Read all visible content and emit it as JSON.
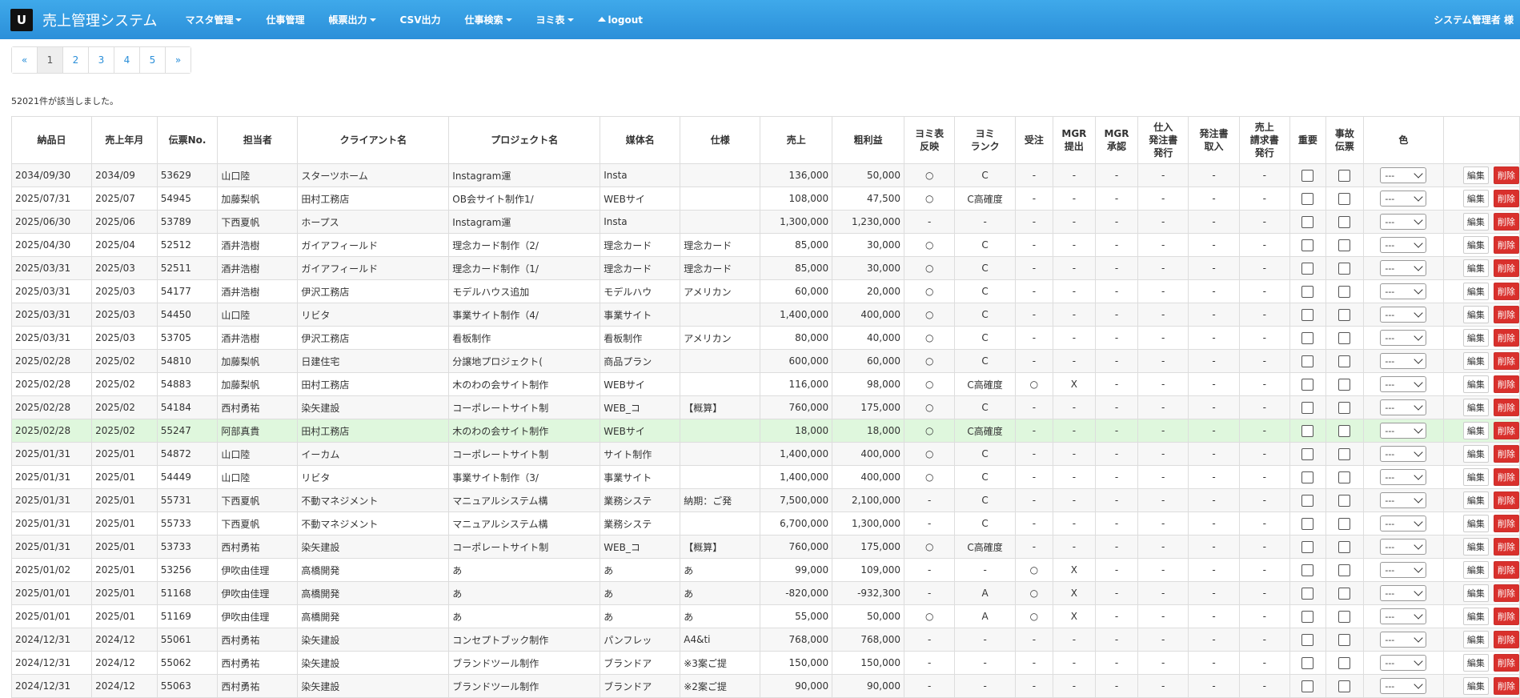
{
  "header": {
    "logo_glyph": "U",
    "title": "売上管理システム",
    "nav": [
      {
        "label": "マスタ管理",
        "dropdown": true
      },
      {
        "label": "仕事管理",
        "dropdown": false
      },
      {
        "label": "帳票出力",
        "dropdown": true
      },
      {
        "label": "CSV出力",
        "dropdown": false
      },
      {
        "label": "仕事検索",
        "dropdown": true
      },
      {
        "label": "ヨミ表",
        "dropdown": true
      }
    ],
    "logout_label": "logout",
    "user": "システム管理者 様"
  },
  "pagination": [
    "«",
    "1",
    "2",
    "3",
    "4",
    "5",
    "»"
  ],
  "pagination_active": "1",
  "result_count": "52021件が該当しました。",
  "columns": [
    "納品日",
    "売上年月",
    "伝票No.",
    "担当者",
    "クライアント名",
    "プロジェクト名",
    "媒体名",
    "仕様",
    "売上",
    "粗利益",
    "ヨミ表\n反映",
    "ヨミ\nランク",
    "受注",
    "MGR\n提出",
    "MGR\n承認",
    "仕入\n発注書\n発行",
    "発注書\n取入",
    "売上\n請求書\n発行",
    "重要",
    "事故\n伝票",
    "色",
    ""
  ],
  "select_default": "---",
  "edit_label": "編集",
  "delete_label": "削除",
  "colors": {
    "navbar": "#2b8fd9",
    "delete": "#d9302c",
    "highlight": "#dff7dd"
  },
  "rows": [
    [
      "2034/09/30",
      "2034/09",
      "53629",
      "山口陸",
      "スターツホーム",
      "Instagram運",
      "Insta",
      "",
      "136,000",
      "50,000",
      "○",
      "C",
      "-",
      "-",
      "-",
      "-",
      "-",
      "-"
    ],
    [
      "2025/07/31",
      "2025/07",
      "54945",
      "加藤梨帆",
      "田村工務店",
      "OB会サイト制作1/",
      "WEBサイ",
      "",
      "108,000",
      "47,500",
      "○",
      "C高確度",
      "-",
      "-",
      "-",
      "-",
      "-",
      "-"
    ],
    [
      "2025/06/30",
      "2025/06",
      "53789",
      "下西夏帆",
      "ホープス",
      "Instagram運",
      "Insta",
      "",
      "1,300,000",
      "1,230,000",
      "-",
      "-",
      "-",
      "-",
      "-",
      "-",
      "-",
      "-"
    ],
    [
      "2025/04/30",
      "2025/04",
      "52512",
      "酒井浩樹",
      "ガイアフィールド",
      "理念カード制作（2/",
      "理念カード",
      "理念カード",
      "85,000",
      "30,000",
      "○",
      "C",
      "-",
      "-",
      "-",
      "-",
      "-",
      "-"
    ],
    [
      "2025/03/31",
      "2025/03",
      "52511",
      "酒井浩樹",
      "ガイアフィールド",
      "理念カード制作（1/",
      "理念カード",
      "理念カード",
      "85,000",
      "30,000",
      "○",
      "C",
      "-",
      "-",
      "-",
      "-",
      "-",
      "-"
    ],
    [
      "2025/03/31",
      "2025/03",
      "54177",
      "酒井浩樹",
      "伊沢工務店",
      "モデルハウス追加",
      "モデルハウ",
      "アメリカン",
      "60,000",
      "20,000",
      "○",
      "C",
      "-",
      "-",
      "-",
      "-",
      "-",
      "-"
    ],
    [
      "2025/03/31",
      "2025/03",
      "54450",
      "山口陸",
      "リビタ",
      "事業サイト制作（4/",
      "事業サイト",
      "",
      "1,400,000",
      "400,000",
      "○",
      "C",
      "-",
      "-",
      "-",
      "-",
      "-",
      "-"
    ],
    [
      "2025/03/31",
      "2025/03",
      "53705",
      "酒井浩樹",
      "伊沢工務店",
      "看板制作",
      "看板制作",
      "アメリカン",
      "80,000",
      "40,000",
      "○",
      "C",
      "-",
      "-",
      "-",
      "-",
      "-",
      "-"
    ],
    [
      "2025/02/28",
      "2025/02",
      "54810",
      "加藤梨帆",
      "日建住宅",
      "分譲地プロジェクト(",
      "商品プラン",
      "",
      "600,000",
      "60,000",
      "○",
      "C",
      "-",
      "-",
      "-",
      "-",
      "-",
      "-"
    ],
    [
      "2025/02/28",
      "2025/02",
      "54883",
      "加藤梨帆",
      "田村工務店",
      "木のわの会サイト制作",
      "WEBサイ",
      "",
      "116,000",
      "98,000",
      "○",
      "C高確度",
      "○",
      "X",
      "-",
      "-",
      "-",
      "-"
    ],
    [
      "2025/02/28",
      "2025/02",
      "54184",
      "西村勇祐",
      "染矢建設",
      "コーポレートサイト制",
      "WEB_コ",
      "【概算】",
      "760,000",
      "175,000",
      "○",
      "C",
      "-",
      "-",
      "-",
      "-",
      "-",
      "-"
    ],
    [
      "2025/02/28",
      "2025/02",
      "55247",
      "阿部真貴",
      "田村工務店",
      "木のわの会サイト制作",
      "WEBサイ",
      "",
      "18,000",
      "18,000",
      "○",
      "C高確度",
      "-",
      "-",
      "-",
      "-",
      "-",
      "-"
    ],
    [
      "2025/01/31",
      "2025/01",
      "54872",
      "山口陸",
      "イーカム",
      "コーポレートサイト制",
      "サイト制作",
      "",
      "1,400,000",
      "400,000",
      "○",
      "C",
      "-",
      "-",
      "-",
      "-",
      "-",
      "-"
    ],
    [
      "2025/01/31",
      "2025/01",
      "54449",
      "山口陸",
      "リビタ",
      "事業サイト制作（3/",
      "事業サイト",
      "",
      "1,400,000",
      "400,000",
      "○",
      "C",
      "-",
      "-",
      "-",
      "-",
      "-",
      "-"
    ],
    [
      "2025/01/31",
      "2025/01",
      "55731",
      "下西夏帆",
      "不動マネジメント",
      "マニュアルシステム構",
      "業務システ",
      "納期：ご発",
      "7,500,000",
      "2,100,000",
      "-",
      "C",
      "-",
      "-",
      "-",
      "-",
      "-",
      "-"
    ],
    [
      "2025/01/31",
      "2025/01",
      "55733",
      "下西夏帆",
      "不動マネジメント",
      "マニュアルシステム構",
      "業務システ",
      "",
      "6,700,000",
      "1,300,000",
      "-",
      "C",
      "-",
      "-",
      "-",
      "-",
      "-",
      "-"
    ],
    [
      "2025/01/31",
      "2025/01",
      "53733",
      "西村勇祐",
      "染矢建設",
      "コーポレートサイト制",
      "WEB_コ",
      "【概算】",
      "760,000",
      "175,000",
      "○",
      "C高確度",
      "-",
      "-",
      "-",
      "-",
      "-",
      "-"
    ],
    [
      "2025/01/02",
      "2025/01",
      "53256",
      "伊吹由佳理",
      "高橋開発",
      "あ",
      "あ",
      "あ",
      "99,000",
      "109,000",
      "-",
      "-",
      "○",
      "X",
      "-",
      "-",
      "-",
      "-"
    ],
    [
      "2025/01/01",
      "2025/01",
      "51168",
      "伊吹由佳理",
      "高橋開発",
      "あ",
      "あ",
      "あ",
      "-820,000",
      "-932,300",
      "-",
      "A",
      "○",
      "X",
      "-",
      "-",
      "-",
      "-"
    ],
    [
      "2025/01/01",
      "2025/01",
      "51169",
      "伊吹由佳理",
      "高橋開発",
      "あ",
      "あ",
      "あ",
      "55,000",
      "50,000",
      "○",
      "A",
      "○",
      "X",
      "-",
      "-",
      "-",
      "-"
    ],
    [
      "2024/12/31",
      "2024/12",
      "55061",
      "西村勇祐",
      "染矢建設",
      "コンセプトブック制作",
      "パンフレッ",
      "A4&ti",
      "768,000",
      "768,000",
      "-",
      "-",
      "-",
      "-",
      "-",
      "-",
      "-",
      "-"
    ],
    [
      "2024/12/31",
      "2024/12",
      "55062",
      "西村勇祐",
      "染矢建設",
      "ブランドツール制作",
      "ブランドア",
      "※3案ご提",
      "150,000",
      "150,000",
      "-",
      "-",
      "-",
      "-",
      "-",
      "-",
      "-",
      "-"
    ],
    [
      "2024/12/31",
      "2024/12",
      "55063",
      "西村勇祐",
      "染矢建設",
      "ブランドツール制作",
      "ブランドア",
      "※2案ご提",
      "90,000",
      "90,000",
      "-",
      "-",
      "-",
      "-",
      "-",
      "-",
      "-",
      "-"
    ]
  ],
  "highlight_row": 11
}
